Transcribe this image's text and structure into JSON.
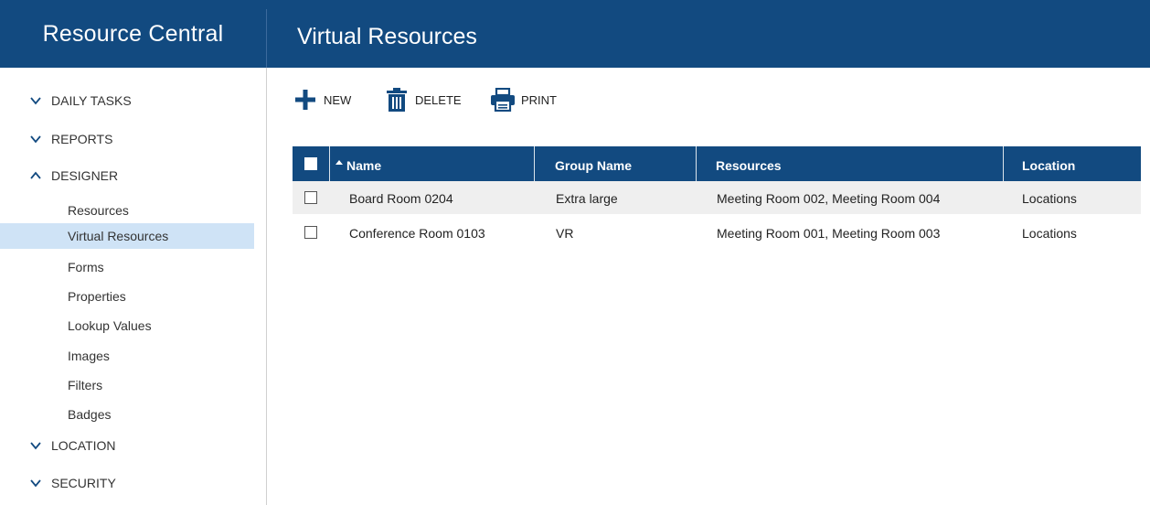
{
  "app": {
    "title": "Resource Central"
  },
  "page": {
    "title": "Virtual Resources"
  },
  "sidebar": {
    "sections": [
      {
        "label": "DAILY TASKS",
        "expanded": false
      },
      {
        "label": "REPORTS",
        "expanded": false
      },
      {
        "label": "DESIGNER",
        "expanded": true
      },
      {
        "label": "LOCATION",
        "expanded": false
      },
      {
        "label": "SECURITY",
        "expanded": false
      }
    ],
    "designer_items": [
      {
        "label": "Resources"
      },
      {
        "label": "Virtual Resources",
        "active": true
      },
      {
        "label": "Forms"
      },
      {
        "label": "Properties"
      },
      {
        "label": "Lookup Values"
      },
      {
        "label": "Images"
      },
      {
        "label": "Filters"
      },
      {
        "label": "Badges"
      }
    ]
  },
  "toolbar": {
    "new_label": "NEW",
    "delete_label": "DELETE",
    "print_label": "PRINT"
  },
  "grid": {
    "columns": [
      "Name",
      "Group Name",
      "Resources",
      "Location"
    ],
    "sort_column": "Name",
    "sort_direction": "ascending",
    "rows": [
      {
        "name": "Board Room 0204",
        "group": "Extra large",
        "resources": "Meeting Room 002, Meeting Room 004",
        "location": "Locations",
        "checked": false
      },
      {
        "name": "Conference Room 0103",
        "group": "VR",
        "resources": "Meeting Room 001, Meeting Room 003",
        "location": "Locations",
        "checked": false
      }
    ]
  },
  "colors": {
    "header_bg": "#124a80",
    "active_nav_bg": "#cfe3f6",
    "alt_row_bg": "#efefef",
    "icon_color": "#124a80"
  },
  "icons": {
    "new": "plus-icon",
    "delete": "trash-icon",
    "print": "printer-icon",
    "collapsed": "chevron-down-icon",
    "expanded": "chevron-up-icon"
  }
}
